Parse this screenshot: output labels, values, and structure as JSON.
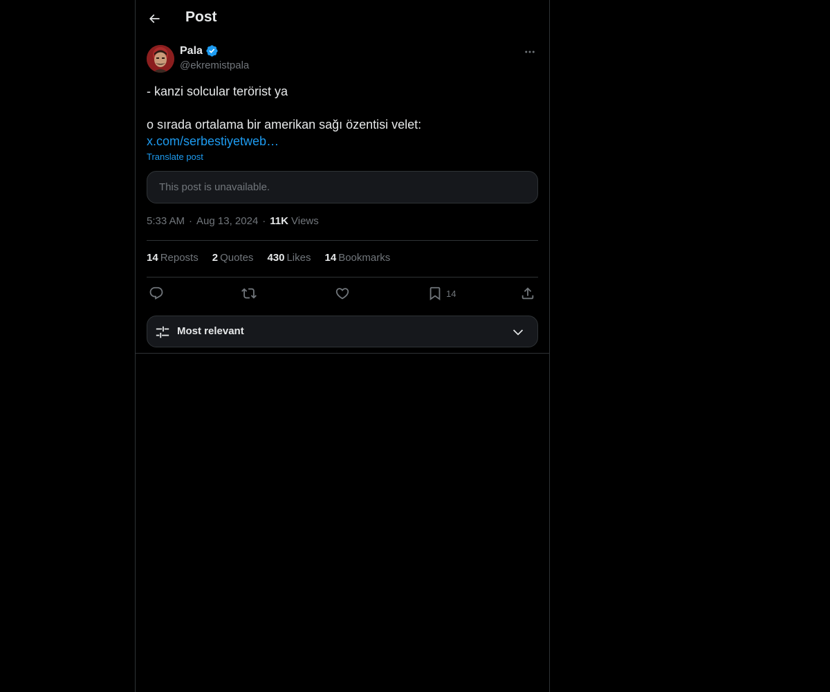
{
  "header": {
    "title": "Post",
    "back_icon": "arrow-left-icon"
  },
  "author": {
    "name": "Pala",
    "handle": "@ekremistpala",
    "verified": true,
    "verified_color": "#1d9bf0"
  },
  "post": {
    "line1": "- kanzi solcular terörist ya",
    "line2": "",
    "line3": "o sırada ortalama bir amerikan sağı özentisi velet:",
    "link": "x.com/serbestiyetweb…",
    "translate": "Translate post",
    "quote_unavailable": "This post is unavailable."
  },
  "meta": {
    "time": "5:33 AM",
    "date": "Aug 13, 2024",
    "views_count": "11K",
    "views_label": "Views"
  },
  "stats": {
    "reposts_count": "14",
    "reposts_label": "Reposts",
    "quotes_count": "2",
    "quotes_label": "Quotes",
    "likes_count": "430",
    "likes_label": "Likes",
    "bookmarks_count": "14",
    "bookmarks_label": "Bookmarks"
  },
  "actions": {
    "reply_icon": "reply-icon",
    "repost_icon": "repost-icon",
    "like_icon": "heart-icon",
    "bookmark_icon": "bookmark-icon",
    "bookmark_count": "14",
    "share_icon": "share-icon"
  },
  "sort": {
    "label": "Most relevant",
    "icon": "sliders-icon",
    "chevron": "chevron-down-icon"
  },
  "colors": {
    "background": "#000000",
    "text": "#e7e9ea",
    "secondary": "#71767b",
    "accent": "#1d9bf0",
    "border": "#2f3336"
  }
}
